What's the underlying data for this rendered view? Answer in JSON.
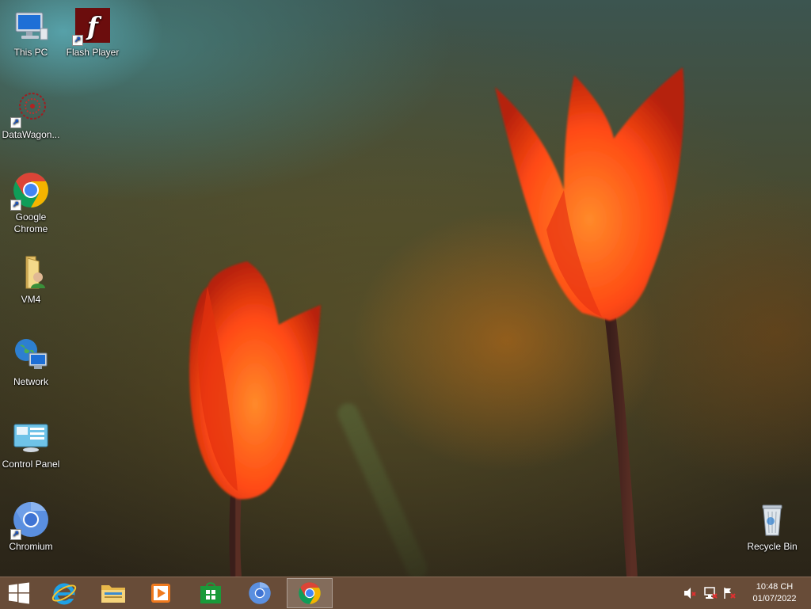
{
  "desktop": {
    "icons": [
      {
        "label": "This PC",
        "icon": "computer-icon"
      },
      {
        "label": "Flash Player",
        "icon": "flash-player-icon"
      },
      {
        "label": "DataWagon...",
        "icon": "datawagon-icon"
      },
      {
        "label": "Google Chrome",
        "icon": "chrome-icon"
      },
      {
        "label": "VM4",
        "icon": "user-folder-icon"
      },
      {
        "label": "Network",
        "icon": "network-icon"
      },
      {
        "label": "Control Panel",
        "icon": "control-panel-icon"
      },
      {
        "label": "Chromium",
        "icon": "chromium-icon"
      },
      {
        "label": "Recycle Bin",
        "icon": "recycle-bin-icon"
      }
    ]
  },
  "taskbar": {
    "pinned": [
      {
        "name": "start-button",
        "icon": "windows-logo-icon"
      },
      {
        "name": "internet-explorer",
        "icon": "internet-explorer-icon"
      },
      {
        "name": "file-explorer",
        "icon": "folder-icon"
      },
      {
        "name": "media-player",
        "icon": "media-player-icon"
      },
      {
        "name": "store",
        "icon": "store-icon"
      },
      {
        "name": "chromium",
        "icon": "chromium-icon"
      },
      {
        "name": "google-chrome",
        "icon": "chrome-icon",
        "active": true
      }
    ],
    "tray": {
      "volume": "speaker-muted-icon",
      "network": "network-disconnected-icon",
      "action_center": "flag-alert-icon"
    },
    "clock": {
      "time": "10:48 CH",
      "date": "01/07/2022"
    }
  },
  "colors": {
    "taskbar": "#6c4e3a",
    "chrome_red": "#db4437",
    "chrome_yellow": "#f4b400",
    "chrome_green": "#0f9d58",
    "chrome_blue": "#4285f4",
    "tulip": "#ff4a14"
  }
}
